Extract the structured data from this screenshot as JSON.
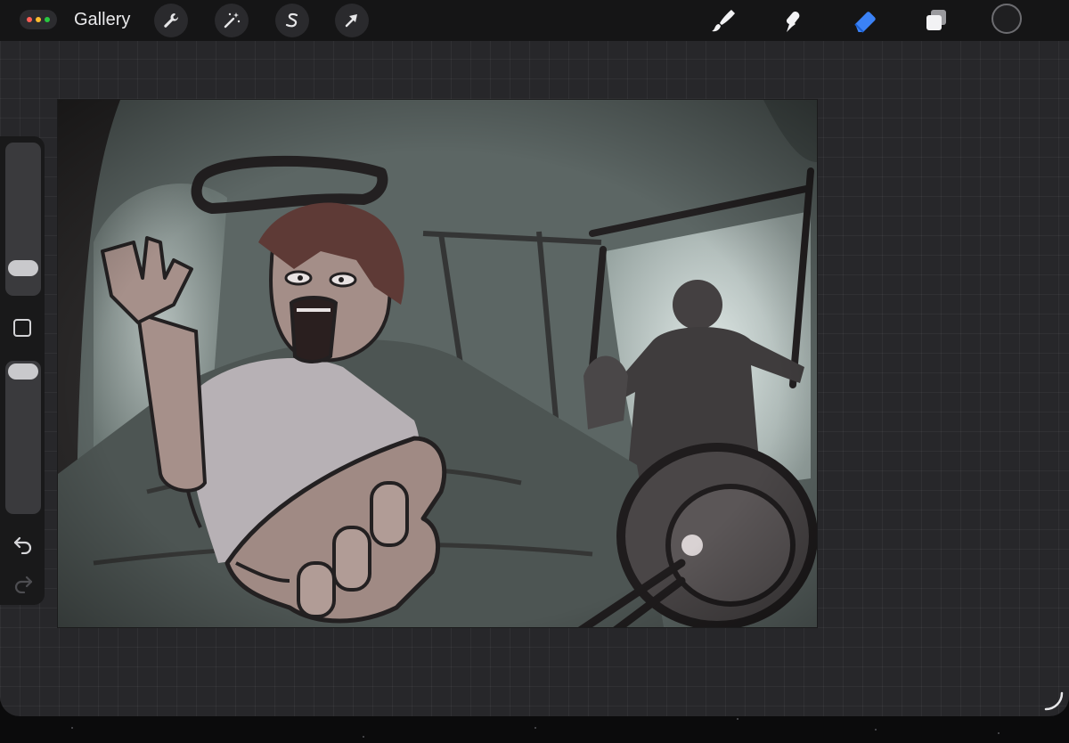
{
  "topbar": {
    "menu_dots_colors": [
      "#ff5f57",
      "#febc2e",
      "#28c840"
    ],
    "gallery_label": "Gallery",
    "left_tools": [
      "wrench-icon",
      "magic-wand-icon",
      "selection-s-icon",
      "arrow-transform-icon"
    ],
    "right_tools": [
      "brush-icon",
      "smudge-icon",
      "eraser-icon",
      "layers-icon"
    ],
    "active_tool": "eraser-icon",
    "accent_color": "#3b82f6",
    "current_color": "#1f1f21"
  },
  "sidebar": {
    "brush_size_level": 0.14,
    "opacity_level": 0.93,
    "controls": [
      "brush-size-slider",
      "modify-square",
      "opacity-slider",
      "undo",
      "redo"
    ]
  },
  "canvas": {
    "content": "illustration",
    "palette": {
      "background": "#5a6462",
      "light": "#c9d4d1",
      "ink": "#232021",
      "skin": "#a08a84",
      "hair": "#5e3a36",
      "shirt": "#b8b2b6",
      "figure": "#3f3c3d"
    }
  }
}
